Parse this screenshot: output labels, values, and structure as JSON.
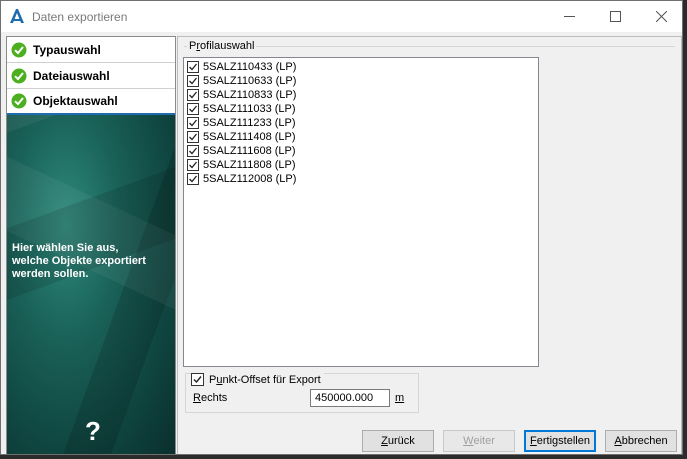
{
  "window": {
    "title": "Daten exportieren"
  },
  "steps": [
    {
      "label": "Typauswahl"
    },
    {
      "label": "Dateiauswahl"
    },
    {
      "label": "Objektauswahl"
    }
  ],
  "hint": {
    "line1": "Hier wählen Sie aus,",
    "line2": "welche Objekte exportiert",
    "line3": "werden sollen."
  },
  "help_symbol": "?",
  "profile": {
    "group_label_pre": "P",
    "group_label_access": "r",
    "group_label_post": "ofilauswahl",
    "items": [
      {
        "label": "5SALZ110433 (LP)",
        "checked": true
      },
      {
        "label": "5SALZ110633 (LP)",
        "checked": true
      },
      {
        "label": "5SALZ110833 (LP)",
        "checked": true
      },
      {
        "label": "5SALZ111033 (LP)",
        "checked": true
      },
      {
        "label": "5SALZ111233 (LP)",
        "checked": true
      },
      {
        "label": "5SALZ111408 (LP)",
        "checked": true
      },
      {
        "label": "5SALZ111608 (LP)",
        "checked": true
      },
      {
        "label": "5SALZ111808 (LP)",
        "checked": true
      },
      {
        "label": "5SALZ112008 (LP)",
        "checked": true
      }
    ]
  },
  "offset": {
    "checkbox_label_pre": "P",
    "checkbox_label_access": "u",
    "checkbox_label_post": "nkt-Offset für Export",
    "checked": true,
    "rechts_label_access": "R",
    "rechts_label_post": "echts",
    "rechts_value": "450000.000",
    "unit": "m"
  },
  "buttons": {
    "back_access": "Z",
    "back_post": "urück",
    "next_access": "W",
    "next_post": "eiter",
    "finish_access": "F",
    "finish_post": "ertigstellen",
    "cancel_access": "A",
    "cancel_post": "bbrechen"
  },
  "colors": {
    "step_check": "#4caf1f",
    "accent": "#0078d7",
    "panel_teal": "#1a6259"
  }
}
